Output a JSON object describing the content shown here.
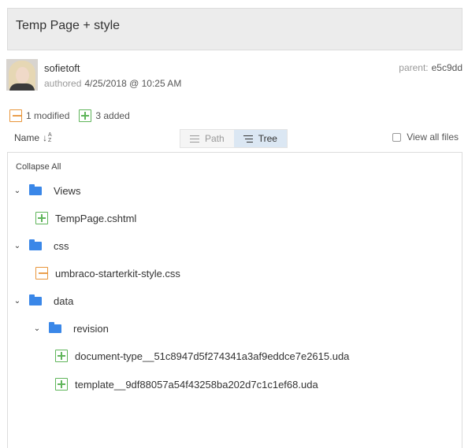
{
  "commit": {
    "message": "Temp Page + style",
    "author": "sofietoft",
    "authored_label": "authored",
    "authored_date": "4/25/2018 @ 10:25 AM",
    "parent_label": "parent:",
    "parent_hash": "e5c9dd"
  },
  "summary": {
    "modified": "1 modified",
    "added": "3 added"
  },
  "toolbar": {
    "name_label": "Name",
    "path_label": "Path",
    "tree_label": "Tree",
    "view_all_label": "View all files",
    "active_view": "Tree"
  },
  "tree": {
    "collapse_all": "Collapse All",
    "items": [
      {
        "type": "folder",
        "label": "Views",
        "expanded": true
      },
      {
        "type": "file",
        "label": "TempPage.cshtml",
        "status": "added"
      },
      {
        "type": "folder",
        "label": "css",
        "expanded": true
      },
      {
        "type": "file",
        "label": "umbraco-starterkit-style.css",
        "status": "modified"
      },
      {
        "type": "folder",
        "label": "data",
        "expanded": true
      },
      {
        "type": "folder",
        "label": "revision",
        "expanded": true
      },
      {
        "type": "file",
        "label": "document-type__51c8947d5f274341a3af9eddce7e2615.uda",
        "status": "added"
      },
      {
        "type": "file",
        "label": "template__9df88057a54f43258ba202d7c1c1ef68.uda",
        "status": "added"
      }
    ]
  },
  "colors": {
    "modified": "#e8953a",
    "added": "#5fb55a",
    "folder": "#3a87e8",
    "active_toggle": "#dbe7f3"
  }
}
